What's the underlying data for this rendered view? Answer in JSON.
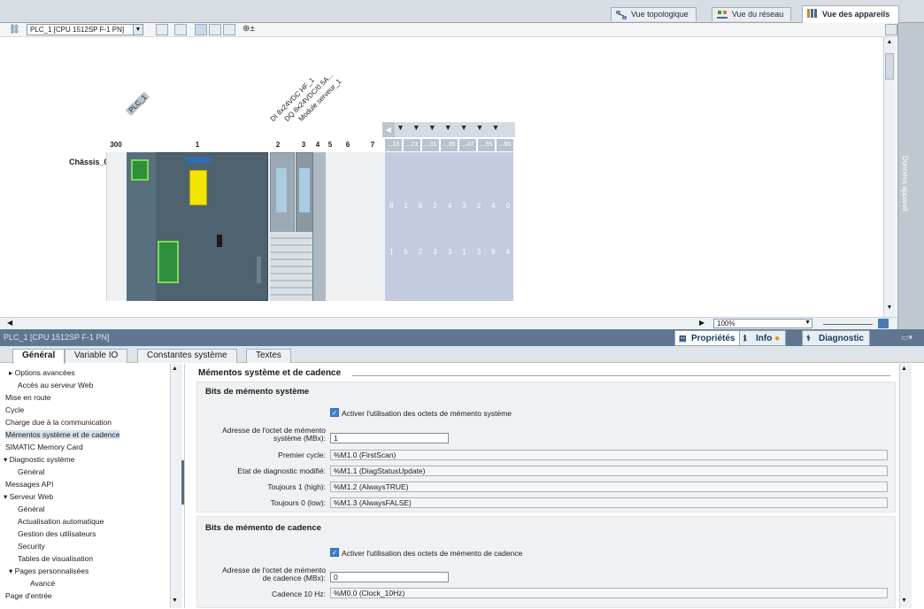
{
  "view_tabs": [
    {
      "label": "Vue topologique"
    },
    {
      "label": "Vue du réseau"
    },
    {
      "label": "Vue des appareils"
    }
  ],
  "toolbar": {
    "device_select": "PLC_1 [CPU 1512SP F-1 PN]"
  },
  "canvas": {
    "plc_label": "PLC_1",
    "module_labels": [
      "DI 8x24VDC HF_1",
      "DQ 8x24VDC/0.5A...",
      "Module serveur_1"
    ],
    "rack_label": "Châssis_0",
    "slot_numbers": [
      "300",
      "1",
      "2",
      "3",
      "4",
      "5",
      "6",
      "7",
      "...15",
      "...23",
      "...31",
      "...39",
      "...47",
      "...55",
      "...66"
    ],
    "slot_top_nums": [
      "8",
      "16",
      "24",
      "32",
      "40",
      "48",
      "56"
    ],
    "slot_bottom_nums": [
      "15",
      "23",
      "31",
      "39",
      "47",
      "55",
      "66"
    ],
    "zoom": "100%",
    "side_tab": "Données appareil"
  },
  "properties": {
    "title": "PLC_1 [CPU 1512SP F-1 PN]",
    "tabs": [
      {
        "label": "Propriétés"
      },
      {
        "label": "Info"
      },
      {
        "label": "Diagnostic"
      }
    ],
    "subtabs": [
      {
        "label": "Général"
      },
      {
        "label": "Variable IO"
      },
      {
        "label": "Constantes système"
      },
      {
        "label": "Textes"
      }
    ]
  },
  "nav": [
    {
      "label": "▸ Options avancées"
    },
    {
      "label": "Accès au serveur Web"
    },
    {
      "label": "Mise en route"
    },
    {
      "label": "Cycle"
    },
    {
      "label": "Charge due à la communication"
    },
    {
      "label": "Mémentos système et de cadence"
    },
    {
      "label": "SIMATIC Memory Card"
    },
    {
      "label": "▾ Diagnostic système"
    },
    {
      "label": "Général"
    },
    {
      "label": "Messages API"
    },
    {
      "label": "▾ Serveur Web"
    },
    {
      "label": "Général"
    },
    {
      "label": "Actualisation automatique"
    },
    {
      "label": "Gestion des utilisateurs"
    },
    {
      "label": "Security"
    },
    {
      "label": "Tables de visualisation"
    },
    {
      "label": "▾ Pages personnalisées"
    },
    {
      "label": "Avancé"
    },
    {
      "label": "Page d'entrée"
    }
  ],
  "content": {
    "heading": "Mémentos système et de cadence",
    "system": {
      "title": "Bits de mémento système",
      "checkbox_label": "Activer l'utilisation des octets de mémento système",
      "address_label_1": "Adresse de l'octet de mémento",
      "address_label_2": "système (MBx):",
      "address_value": "1",
      "rows": [
        {
          "label": "Premier cycle:",
          "value": "%M1.0 (FirstScan)"
        },
        {
          "label": "Etat de diagnostic modifié:",
          "value": "%M1.1 (DiagStatusUpdate)"
        },
        {
          "label": "Toujours 1 (high):",
          "value": "%M1.2 (AlwaysTRUE)"
        },
        {
          "label": "Toujours 0 (low):",
          "value": "%M1.3 (AlwaysFALSE)"
        }
      ]
    },
    "clock": {
      "title": "Bits de mémento de cadence",
      "checkbox_label": "Activer l'utilisation des octets de mémento de cadence",
      "address_label_1": "Adresse de l'octet de mémento",
      "address_label_2": "de cadence (MBx):",
      "address_value": "0",
      "rows": [
        {
          "label": "Cadence  10 Hz:",
          "value": "%M0.0 (Clock_10Hz)"
        }
      ]
    }
  }
}
